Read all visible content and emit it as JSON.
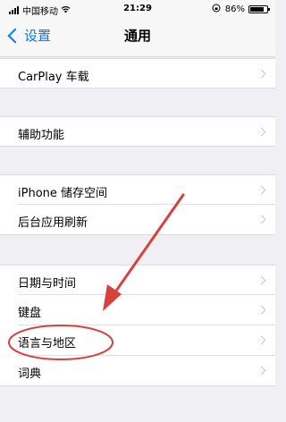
{
  "status": {
    "carrier": "中国移动",
    "time": "21:29",
    "battery_percent": "86%",
    "battery_level": 0.86,
    "icons": [
      "signal-icon",
      "wifi-icon",
      "lock-rotation-icon",
      "battery-icon"
    ]
  },
  "nav": {
    "back_label": "设置",
    "title": "通用"
  },
  "groups": [
    {
      "items": [
        {
          "label": "CarPlay 车载"
        }
      ]
    },
    {
      "items": [
        {
          "label": "辅助功能"
        }
      ]
    },
    {
      "items": [
        {
          "label": "iPhone 储存空间"
        },
        {
          "label": "后台应用刷新"
        }
      ]
    },
    {
      "items": [
        {
          "label": "日期与时间"
        },
        {
          "label": "键盘"
        },
        {
          "label": "语言与地区"
        },
        {
          "label": "词典"
        }
      ]
    }
  ],
  "annotation": {
    "color": "#d9413f",
    "highlighted_item": "语言与地区",
    "shapes": [
      "arrow",
      "ellipse"
    ]
  }
}
